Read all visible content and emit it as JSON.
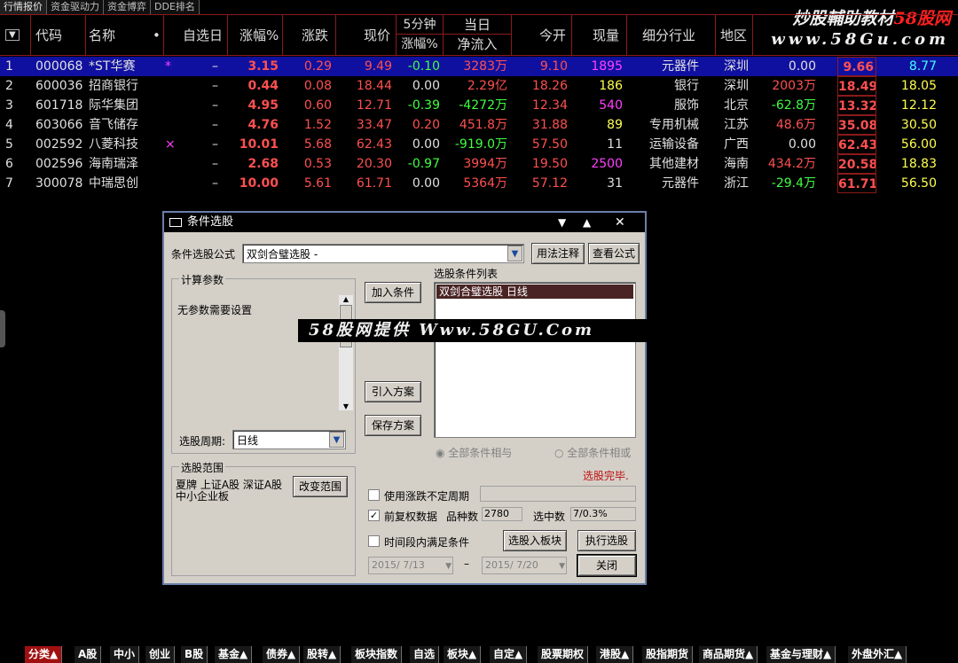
{
  "topbar": {
    "tabs": [
      "行情报价",
      "资金驱动力",
      "资金博弈",
      "DDE排名"
    ]
  },
  "watermark": {
    "line1": "炒股輔助教材",
    "line1_red": "58股网",
    "line2": "www.58Gu.com",
    "center": "58股网提供  Www.58GU.Com"
  },
  "table": {
    "headers": {
      "menu": "▼",
      "code": "代码",
      "name": "名称",
      "dot": "•",
      "selfdate": "自选日",
      "pct": "涨幅%",
      "chg": "涨跌",
      "price": "现价",
      "min5_top": "5分钟",
      "min5_bot": "涨幅%",
      "day_top": "当日",
      "day_bot": "净流入",
      "open": "今开",
      "vol": "现量",
      "industry": "细分行业",
      "region": "地区"
    },
    "rows": [
      {
        "idx": "1",
        "code": "000068",
        "name": "*ST华赛",
        "mark": "*",
        "self": "–",
        "pct": "3.15",
        "chg": "0.29",
        "price": "9.49",
        "m5": "-0.10",
        "flow": "3283万",
        "open": "9.10",
        "vol": "1895",
        "ind": "元器件",
        "reg": "深圳",
        "c1": "0.00",
        "c2": "9.66",
        "c3": "8.77"
      },
      {
        "idx": "2",
        "code": "600036",
        "name": "招商银行",
        "mark": "",
        "self": "–",
        "pct": "0.44",
        "chg": "0.08",
        "price": "18.44",
        "m5": "0.00",
        "flow": "2.29亿",
        "open": "18.26",
        "vol": "186",
        "ind": "银行",
        "reg": "深圳",
        "c1": "2003万",
        "c2": "18.49",
        "c3": "18.05"
      },
      {
        "idx": "3",
        "code": "601718",
        "name": "际华集团",
        "mark": "",
        "self": "–",
        "pct": "4.95",
        "chg": "0.60",
        "price": "12.71",
        "m5": "-0.39",
        "flow": "-4272万",
        "open": "12.34",
        "vol": "540",
        "ind": "服饰",
        "reg": "北京",
        "c1": "-62.8万",
        "c2": "13.32",
        "c3": "12.12"
      },
      {
        "idx": "4",
        "code": "603066",
        "name": "音飞储存",
        "mark": "",
        "self": "–",
        "pct": "4.76",
        "chg": "1.52",
        "price": "33.47",
        "m5": "0.20",
        "flow": "451.8万",
        "open": "31.88",
        "vol": "89",
        "ind": "专用机械",
        "reg": "江苏",
        "c1": "48.6万",
        "c2": "35.08",
        "c3": "30.50"
      },
      {
        "idx": "5",
        "code": "002592",
        "name": "八菱科技",
        "mark": "×",
        "self": "–",
        "pct": "10.01",
        "chg": "5.68",
        "price": "62.43",
        "m5": "0.00",
        "flow": "-919.0万",
        "open": "57.50",
        "vol": "11",
        "ind": "运输设备",
        "reg": "广西",
        "c1": "0.00",
        "c2": "62.43",
        "c3": "56.00"
      },
      {
        "idx": "6",
        "code": "002596",
        "name": "海南瑞泽",
        "mark": "",
        "self": "–",
        "pct": "2.68",
        "chg": "0.53",
        "price": "20.30",
        "m5": "-0.97",
        "flow": "3994万",
        "open": "19.50",
        "vol": "2500",
        "ind": "其他建材",
        "reg": "海南",
        "c1": "434.2万",
        "c2": "20.58",
        "c3": "18.83"
      },
      {
        "idx": "7",
        "code": "300078",
        "name": "中瑞思创",
        "mark": "",
        "self": "–",
        "pct": "10.00",
        "chg": "5.61",
        "price": "61.71",
        "m5": "0.00",
        "flow": "5364万",
        "open": "57.12",
        "vol": "31",
        "ind": "元器件",
        "reg": "浙江",
        "c1": "-29.4万",
        "c2": "61.71",
        "c3": "56.50"
      }
    ]
  },
  "dialog": {
    "title": "条件选股",
    "formula_label": "条件选股公式",
    "formula_value": "双剑合璧选股 -",
    "btn_usage": "用法注释",
    "btn_view": "查看公式",
    "params_group": "计算参数",
    "params_text": "无参数需要设置",
    "period_label": "选股周期:",
    "period_value": "日线",
    "btn_add": "加入条件",
    "btn_import": "引入方案",
    "btn_save": "保存方案",
    "cond_list_label": "选股条件列表",
    "cond_item": "双剑合璧选股  日线",
    "radio_and": "全部条件相与",
    "radio_or": "全部条件相或",
    "status": "选股完毕.",
    "range_group": "选股范围",
    "range_text": "夏牌 上证A股 深证A股 中小企业板",
    "btn_range": "改变范围",
    "chk_nonfixed": "使用涨跌不定周期",
    "chk_adjust": "前复权数据",
    "count_label": "品种数",
    "count_value": "2780",
    "selected_label": "选中数",
    "selected_value": "7/0.3%",
    "chk_time": "时间段内满足条件",
    "btn_toboard": "选股入板块",
    "btn_run": "执行选股",
    "date_from": "2015/ 7/13",
    "date_sep": "–",
    "date_to": "2015/ 7/20",
    "btn_close": "关闭"
  },
  "bottom_tabs": [
    "分类▲",
    "A股",
    "中小",
    "创业",
    "B股",
    "基金▲",
    "债券▲",
    "股转▲",
    "板块指数",
    "自选",
    "板块▲",
    "自定▲",
    "股票期权",
    "港股▲",
    "股指期货",
    "商品期货▲",
    "基金与理财▲",
    "外盘外汇▲"
  ]
}
